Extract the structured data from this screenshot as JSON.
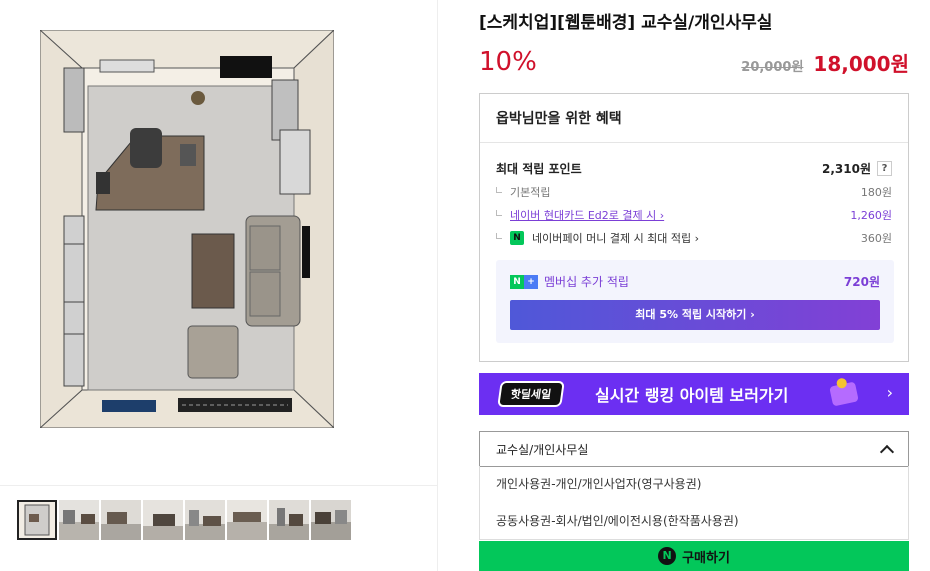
{
  "product": {
    "title": "[스케치업][웹툰배경] 교수실/개인사무실",
    "discount": "10%",
    "original_price": "20,000원",
    "sale_price": "18,000원"
  },
  "benefit": {
    "heading": "옵박님만을 위한 혜택",
    "max_points_label": "최대 적립 포인트",
    "max_points_value": "2,310원",
    "help_icon": "?",
    "items": [
      {
        "label": "기본적립",
        "value": "180원"
      },
      {
        "label": "네이버 현대카드 Ed2로 결제 시 ›",
        "value": "1,260원"
      },
      {
        "label": "네이버페이 머니 결제 시 최대 적립 ›",
        "value": "360원",
        "badge": "N"
      }
    ],
    "membership_label": "멤버십 추가 적립",
    "membership_value": "720원",
    "membership_badge_n": "N",
    "membership_badge_plus": "+",
    "start_button": "최대 5% 적립 시작하기 ›"
  },
  "banner": {
    "logo": "핫딜세일",
    "text": "실시간 랭킹 아이템 보러가기",
    "arrow": "›"
  },
  "option_select": {
    "selected": "교수실/개인사무실",
    "options": [
      "개인사용권-개인/개인사업자(영구사용권)",
      "공동사용권-회사/법인/에이전시용(한작품사용권)"
    ]
  },
  "buy_button": {
    "icon": "N",
    "label": "구매하기"
  },
  "colors": {
    "accent_red": "#d0112b",
    "purple": "#7b3fd6",
    "naver_green": "#03c75a",
    "banner_purple": "#6c2ff2"
  },
  "thumbnails": [
    "thumb-1",
    "thumb-2",
    "thumb-3",
    "thumb-4",
    "thumb-5",
    "thumb-6",
    "thumb-7",
    "thumb-8"
  ]
}
